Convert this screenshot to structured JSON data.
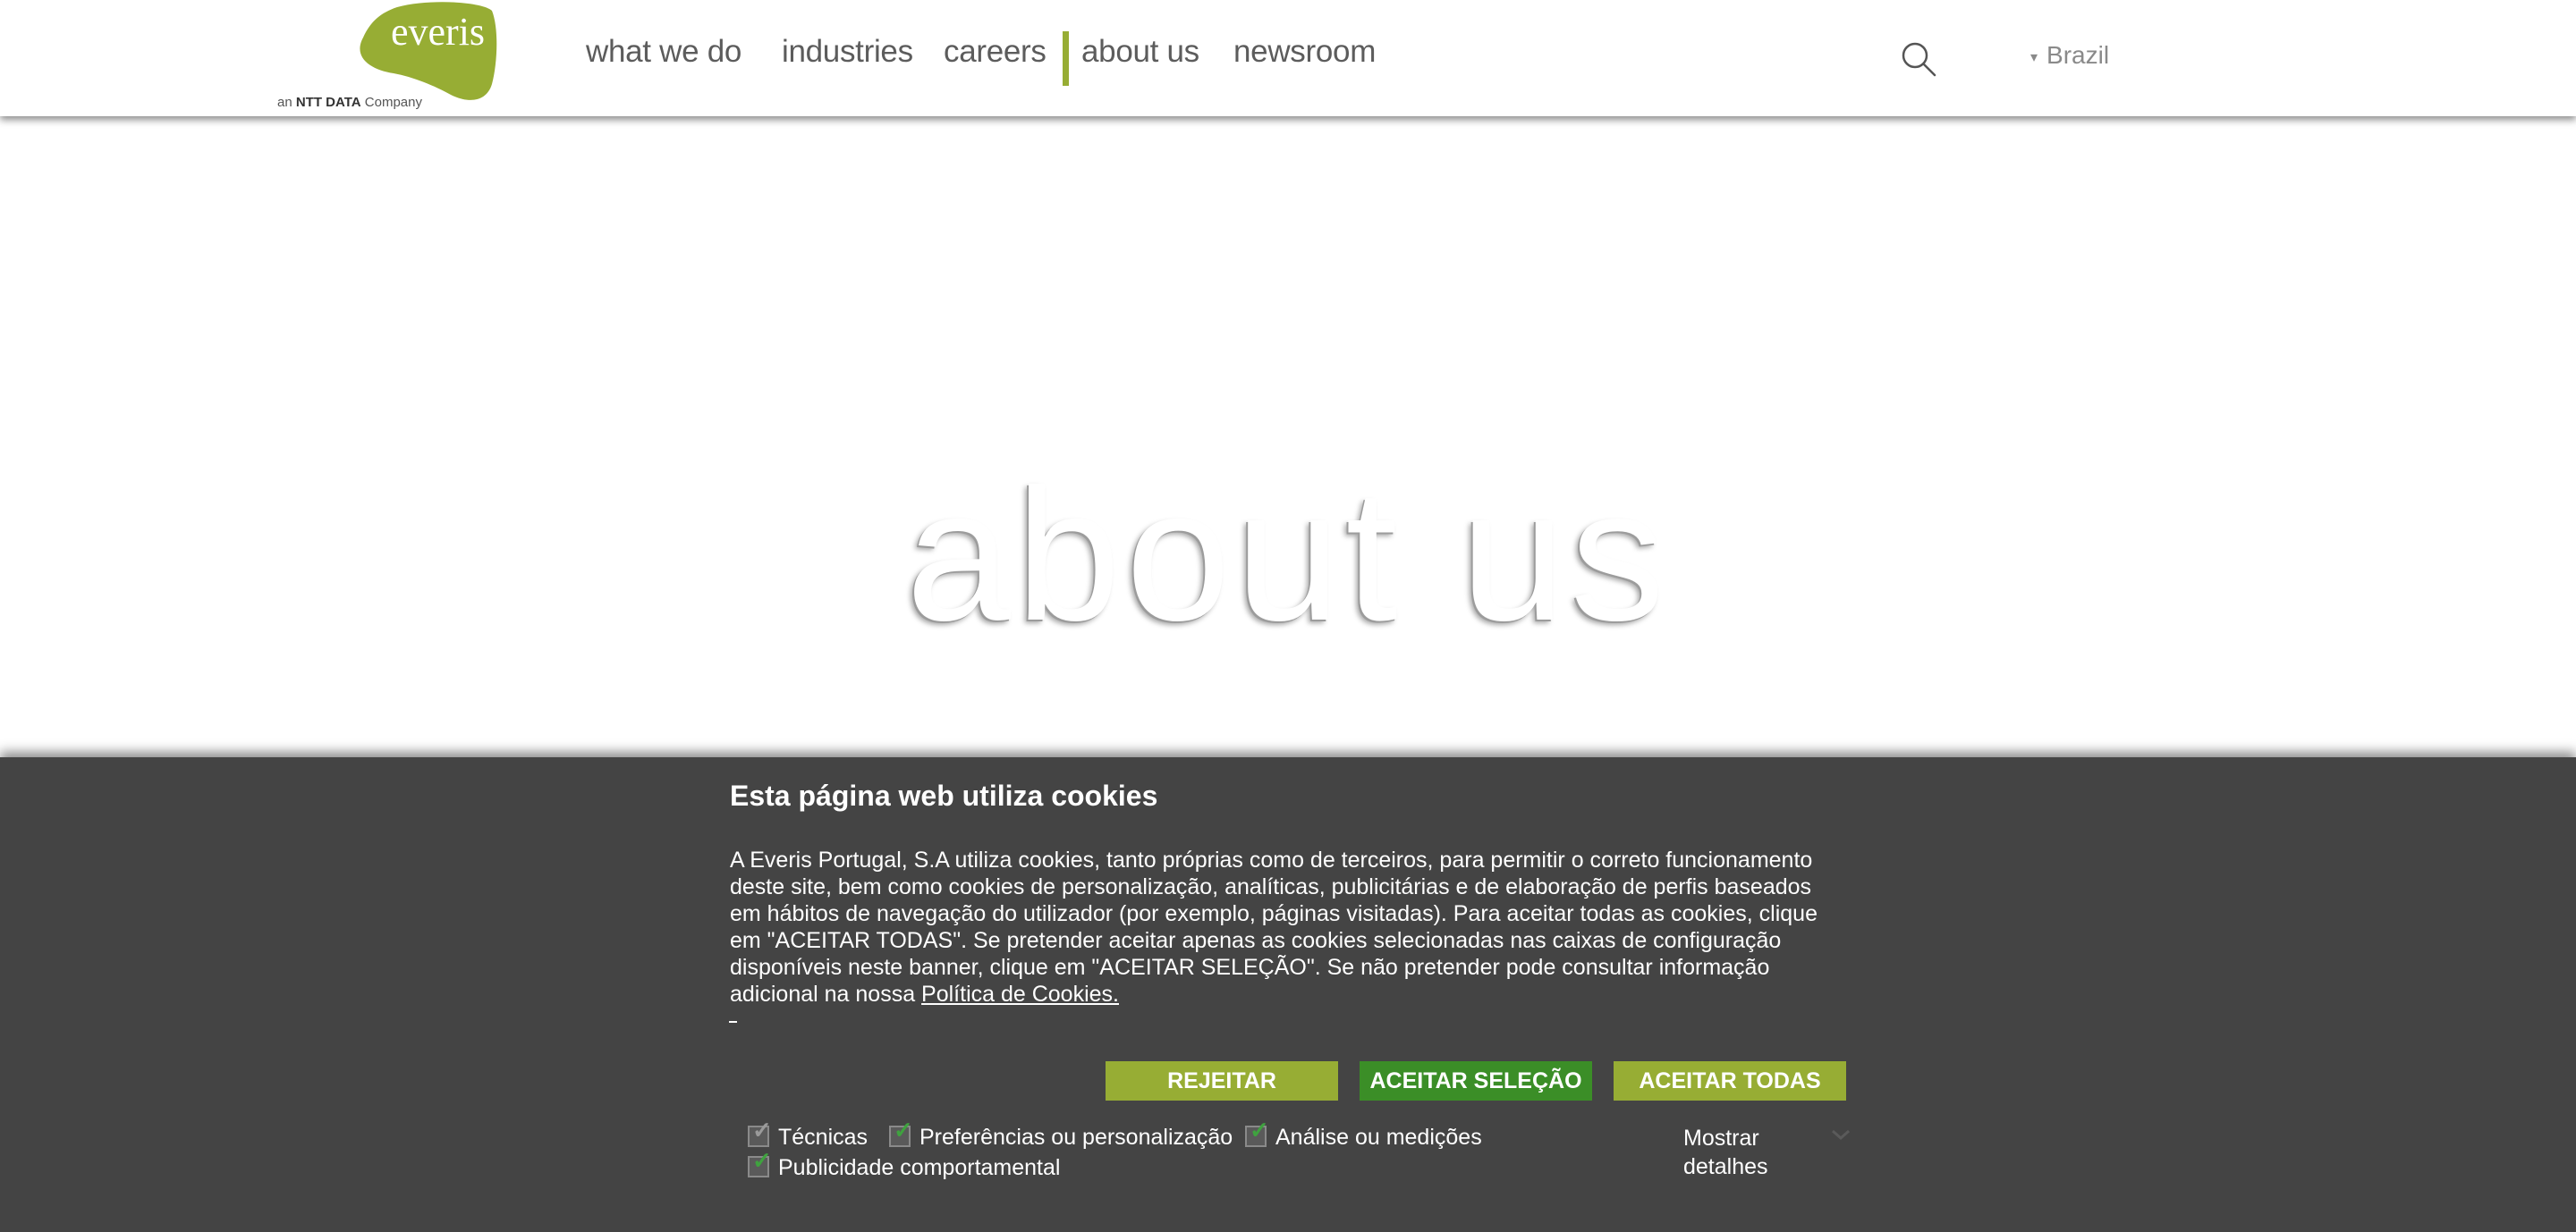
{
  "logo": {
    "word": "everis",
    "tagline_pre": "an",
    "tagline_bold": "NTT DATA",
    "tagline_post": "Company",
    "color": "#97ad34"
  },
  "nav": {
    "items": [
      "what we do",
      "industries",
      "careers",
      "about us",
      "newsroom"
    ],
    "active": "about us",
    "active_color": "#97ad34"
  },
  "search": {
    "icon": "search-icon"
  },
  "country": {
    "caret": "▾",
    "label": "Brazil"
  },
  "hero": {
    "title": "about us"
  },
  "cookie": {
    "title": "Esta página web utiliza cookies",
    "text": "A Everis Portugal, S.A utiliza cookies, tanto próprias como de terceiros, para permitir o correto funcionamento deste site, bem como cookies de personalização, analíticas, publicitárias e de elaboração de perfis baseados em hábitos de navegação do utilizador (por exemplo, páginas visitadas). Para aceitar todas as cookies, clique em \"ACEITAR TODAS\". Se pretender aceitar apenas as cookies selecionadas nas caixas de configuração disponíveis neste banner, clique em \"ACEITAR SELEÇÃO\". Se não pretender pode consultar informação adicional na nossa",
    "policy_link": "Política de Cookies. ",
    "buttons": {
      "reject": "REJEITAR",
      "accept_selection": "ACEITAR SELEÇÃO",
      "accept_all": "ACEITAR TODAS"
    },
    "options": {
      "technical": "Técnicas",
      "preferences": "Preferências ou personalização",
      "analytics": "Análise ou medições",
      "advertising": "Publicidade comportamental"
    },
    "show_details": "Mostrar detalhes",
    "background": "#444444"
  }
}
